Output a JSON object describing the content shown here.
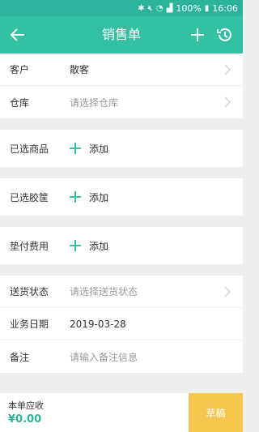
{
  "status_bar": {
    "battery": "100%",
    "time": "16:06"
  },
  "app_bar": {
    "title": "销售单"
  },
  "form": {
    "customer": {
      "label": "客户",
      "value": "散客"
    },
    "warehouse": {
      "label": "仓库",
      "placeholder": "请选择仓库"
    },
    "goods": {
      "label": "已选商品",
      "add": "添加"
    },
    "rubber": {
      "label": "已选胶筐",
      "add": "添加"
    },
    "advance": {
      "label": "垫付费用",
      "add": "添加"
    },
    "delivery": {
      "label": "送货状态",
      "placeholder": "请选择送货状态"
    },
    "date": {
      "label": "业务日期",
      "value": "2019-03-28"
    },
    "note": {
      "label": "备注",
      "placeholder": "请输入备注信息"
    }
  },
  "footer": {
    "total_label": "本单应收",
    "total_value": "¥0.00",
    "draft_button": "草稿"
  },
  "colors": {
    "primary": "#33c1a4",
    "status_bar": "#2bb39b",
    "draft": "#f7c64f"
  }
}
